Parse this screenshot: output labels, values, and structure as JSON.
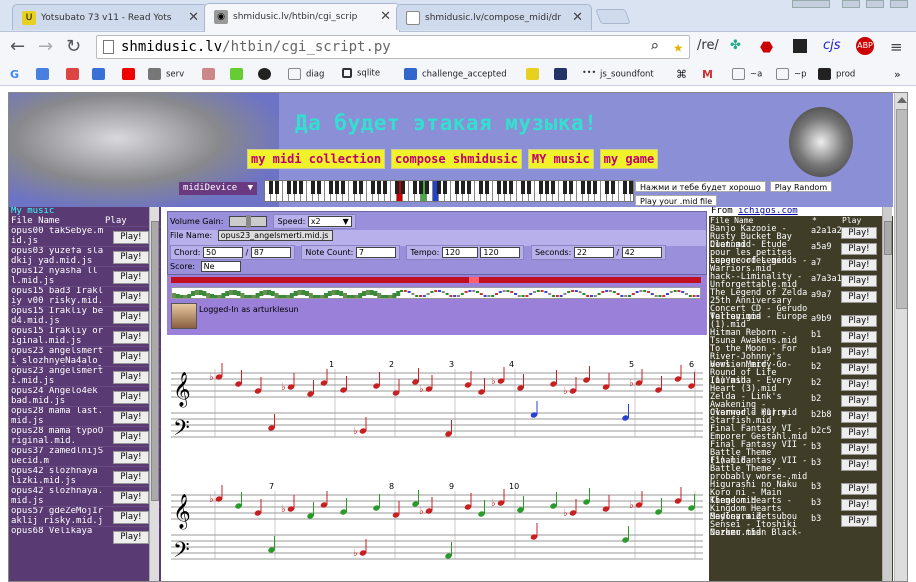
{
  "browser": {
    "tabs": [
      {
        "title": "Yotsubato 73 v11 - Read Yots",
        "active": false
      },
      {
        "title": "shmidusic.lv/htbin/cgi_scrip",
        "active": true
      },
      {
        "title": "shmidusic.lv/compose_midi/dr",
        "active": false
      }
    ],
    "url_domain": "shmidusic.lv",
    "url_path": "/htbin/cgi_script.py",
    "extensions": [
      "/re/",
      "cjs",
      "ABP"
    ],
    "bookmarks": [
      "serv",
      "diag",
      "sqlite",
      "challenge_accepted",
      "js_soundfont",
      "~a",
      "~p",
      "prod"
    ]
  },
  "site": {
    "title": "Да будет этакая музыка!",
    "nav": [
      "my midi collection",
      "compose shmidusic",
      "MY music",
      "my game"
    ],
    "midi_device": "midiDevice",
    "hint_button": "Нажми и тебе будет хорошо",
    "play_random": "Play Random",
    "play_your_mid": "Play your .mid file"
  },
  "left": {
    "heading": "My music",
    "col_file": "File Name",
    "col_play": "Play",
    "play_label": "Play!",
    "items": [
      "opus00 takSebye.mid.js",
      "opus03 yuzefa sladkij yad.mid.js",
      "opus12 nyasha lll.mid.js",
      "opus15 bad3 Irakliy v00 risky.mid.js",
      "opus15 Irakliy bed4.mid.js",
      "opus15 Irakliy original.mid.js",
      "opus23 angelsmerti slozhnyeNa4alo ubasazvesdnajabole",
      "opus23 angelsmerti.mid.js",
      "opus24 Angelo4ek bad.mid.js",
      "opus28 mama last.mid.js",
      "opus28 mama typoOriginal.mid.",
      "opus37 zamedlnijSuecid.m",
      "opus42 slozhnaya lizki.mid.js",
      "opus42 slozhnaya.mid.js",
      "opus57 gdeZeMojIraklij risky.mid.js",
      "opus68 Velikaya"
    ]
  },
  "controls": {
    "volume_label": "Volume Gain:",
    "speed_label": "Speed:",
    "speed_value": "x2",
    "filename_label": "File Name:",
    "filename_value": "opus23_angelsmerti.mid.js",
    "chord_label": "Chord:",
    "chord_current": "50",
    "chord_total": "87",
    "notecount_label": "Note Count:",
    "notecount_value": "7",
    "tempo_label": "Tempo:",
    "tempo_value": "120",
    "tempo_value2": "120",
    "seconds_label": "Seconds:",
    "seconds_current": "22",
    "seconds_total": "42",
    "score_label": "Score:",
    "score_value": "Ne",
    "logged_in": "Logged-In as arturklesun"
  },
  "score": {
    "row1_measures": [
      "1",
      "2",
      "3",
      "4",
      "5",
      "6"
    ],
    "row2_measures": [
      "7",
      "8",
      "9",
      "10"
    ]
  },
  "right": {
    "from_label": "From",
    "from_link": "ichigos.com",
    "col_file": "File Name",
    "col_key": "*",
    "col_play": "Play",
    "play_label": "Play!",
    "items": [
      {
        "name": "Banjo Kazooie - Rusty Bucket Bay Duet.mid",
        "key": "a2a1a2"
      },
      {
        "name": "Clannad - Etude pour les petites supercordes.mid",
        "key": "a5a9"
      },
      {
        "name": "League of Legends - Warriors.mid",
        "key": "a7"
      },
      {
        "name": "hack--Liminality - Unforgettable.mid",
        "key": "a7a3a1"
      },
      {
        "name": "The Legend of Zelda 25th Anniversary Concert CD - Gerudo Valley.mid",
        "key": "a9a7"
      },
      {
        "name": "Terranigma - Europe (1).mid",
        "key": "a9b9"
      },
      {
        "name": "Hitman Reborn - Tsuna Awakens.mid",
        "key": "b1"
      },
      {
        "name": "To the Moon - For River-Johnny's Version.mid",
        "key": "b1a9"
      },
      {
        "name": "Howl - Merry-Go-Round of Life (1).mid",
        "key": "b2"
      },
      {
        "name": "InuYasha - Every Heart (3).mid",
        "key": "b2"
      },
      {
        "name": "Zelda - Link's Awakening - Overworld (1).mid",
        "key": "b2"
      },
      {
        "name": "Clannad - Hurry Starfish.mid",
        "key": "b2b8"
      },
      {
        "name": "Final Fantasy VI - Emporer Gestahl.mid",
        "key": "b2c5"
      },
      {
        "name": "Final Fantasy VII - Battle Theme (1).mid",
        "key": "b3"
      },
      {
        "name": "Final Fantasy VII - Battle Theme -probably worse-.mid",
        "key": "b3"
      },
      {
        "name": "Higurashi no Naku Koro ni - Main Theme.mid",
        "key": "b3"
      },
      {
        "name": "Kingdom Hearts - Kingdom Hearts Medley.mid",
        "key": "b3"
      },
      {
        "name": "Sayonara Zetsubou Sensei - Itoshiki Nozomu.mid",
        "key": "b3"
      },
      {
        "name": "Darker than Black-",
        "key": ""
      }
    ]
  }
}
